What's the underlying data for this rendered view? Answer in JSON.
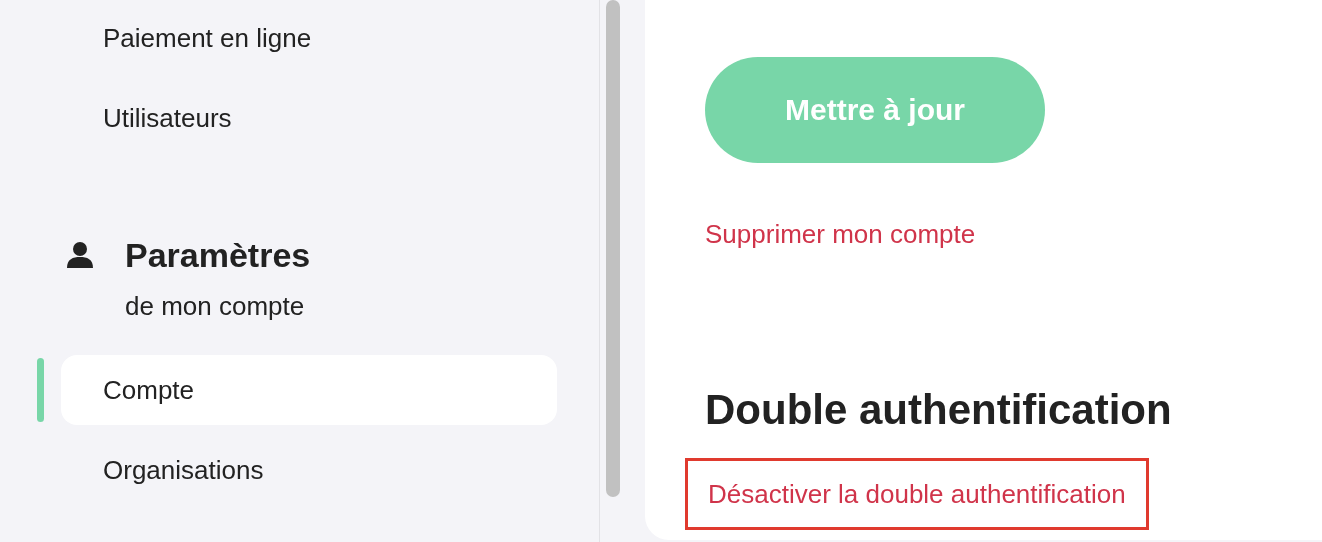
{
  "sidebar": {
    "items_top": [
      {
        "label": "Paiement en ligne",
        "selected": false
      },
      {
        "label": "Utilisateurs",
        "selected": false
      }
    ],
    "section": {
      "title": "Paramètres",
      "subtitle": "de mon compte"
    },
    "items": [
      {
        "label": "Compte",
        "selected": true
      },
      {
        "label": "Organisations",
        "selected": false
      }
    ]
  },
  "main": {
    "update_button": "Mettre à jour",
    "delete_link": "Supprimer mon compte",
    "heading": "Double authentification",
    "disable_link": {
      "label": "Désactiver la double authentification",
      "highlighted": true
    }
  }
}
